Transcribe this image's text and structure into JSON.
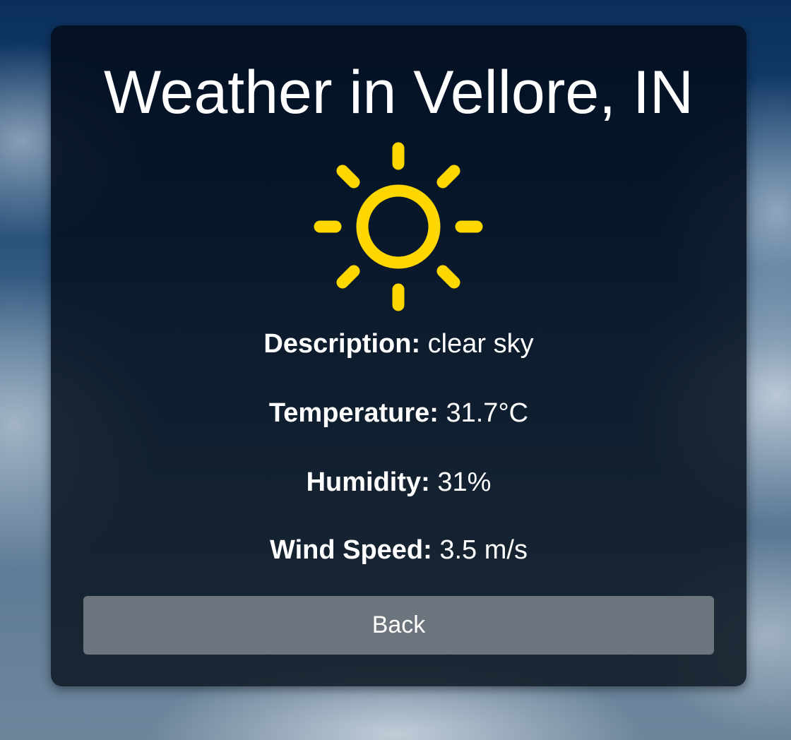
{
  "page": {
    "title": "Weather in Vellore, IN"
  },
  "weather": {
    "icon": "sun-icon",
    "icon_color": "#FFD700",
    "description_label": "Description:",
    "description_value": "clear sky",
    "temperature_label": "Temperature:",
    "temperature_value": "31.7°C",
    "humidity_label": "Humidity:",
    "humidity_value": "31%",
    "wind_label": "Wind Speed:",
    "wind_value": "3.5 m/s"
  },
  "actions": {
    "back_label": "Back",
    "back_color": "#6c757d"
  }
}
